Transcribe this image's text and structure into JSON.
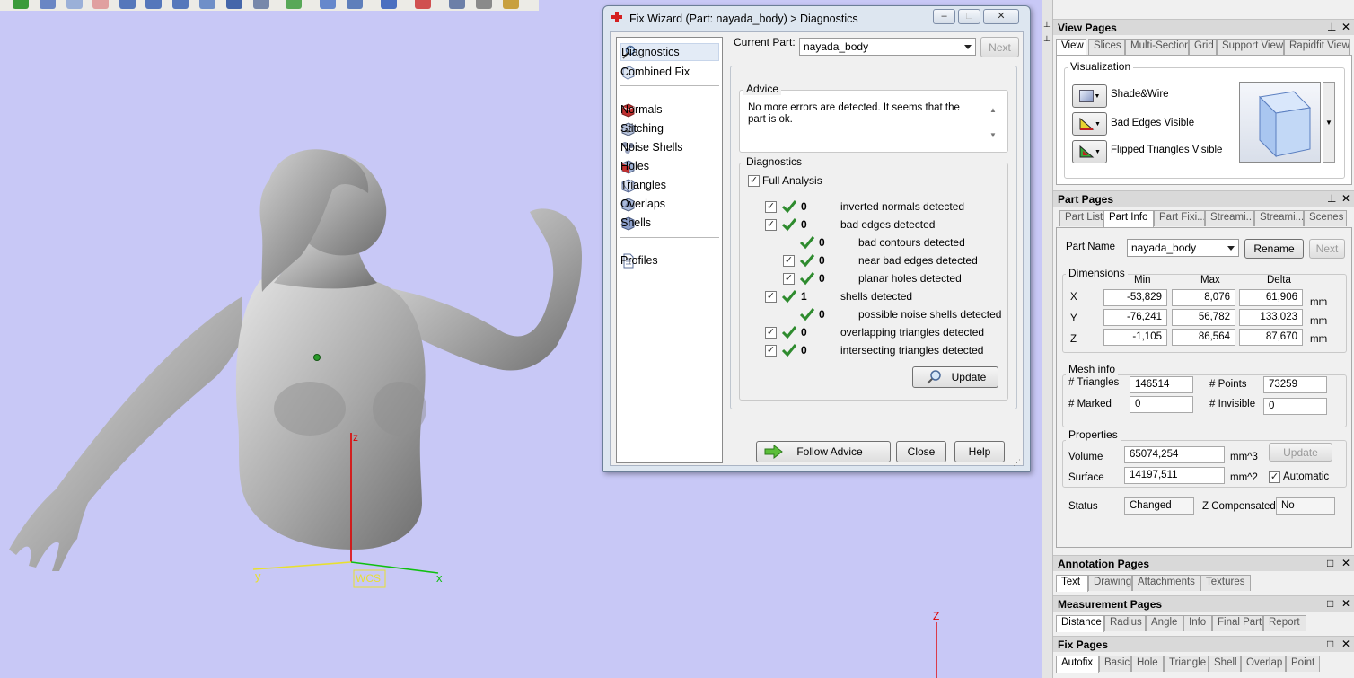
{
  "toolbar": {
    "icons": [
      "fix-icon",
      "search-icon",
      "measure-icon",
      "eraser-icon",
      "cube-icon",
      "cube-icon",
      "cube-icon",
      "arrow-icon",
      "save-icon",
      "view-icon",
      "rotate-icon",
      "cut-icon",
      "move-icon",
      "part-icon",
      "wizard-icon",
      "gear-icon",
      "tools-icon",
      "export-icon"
    ]
  },
  "viewport": {
    "axis_z": "z",
    "axis_y": "y",
    "axis_x": "x",
    "wcs_label": "WCS",
    "corner_axis_z": "Z"
  },
  "dialog": {
    "title": "Fix Wizard (Part: nayada_body) > Diagnostics",
    "nav": {
      "diagnostics": "Diagnostics",
      "combined_fix": "Combined Fix",
      "normals": "Normals",
      "stitching": "Stitching",
      "noise_shells": "Noise Shells",
      "holes": "Holes",
      "triangles": "Triangles",
      "overlaps": "Overlaps",
      "shells": "Shells",
      "profiles": "Profiles"
    },
    "current_part_label": "Current Part:",
    "current_part_value": "nayada_body",
    "next_label": "Next",
    "advice_title": "Advice",
    "advice_text": "No more errors are detected. It seems that the part is ok.",
    "diagnostics_title": "Diagnostics",
    "full_analysis_label": "Full Analysis",
    "rows": [
      {
        "count": "0",
        "text": "inverted normals detected"
      },
      {
        "count": "0",
        "text": "bad edges detected"
      },
      {
        "count": "0",
        "text": "bad contours detected"
      },
      {
        "count": "0",
        "text": "near bad edges detected"
      },
      {
        "count": "0",
        "text": "planar holes detected"
      },
      {
        "count": "1",
        "text": "shells detected"
      },
      {
        "count": "0",
        "text": "possible noise shells detected"
      },
      {
        "count": "0",
        "text": "overlapping triangles detected"
      },
      {
        "count": "0",
        "text": "intersecting triangles detected"
      }
    ],
    "update_label": "Update",
    "follow_advice_label": "Follow Advice",
    "close_label": "Close",
    "help_label": "Help"
  },
  "view_pages": {
    "title": "View Pages",
    "tabs": [
      "View",
      "Slices",
      "Multi-Section",
      "Grid",
      "Support View",
      "Rapidfit View"
    ],
    "visualization_title": "Visualization",
    "shade_wire": "Shade&Wire",
    "bad_edges": "Bad Edges Visible",
    "flipped_triangles": "Flipped Triangles Visible"
  },
  "part_pages": {
    "title": "Part Pages",
    "tabs": [
      "Part List",
      "Part Info",
      "Part Fixi...",
      "Streami...",
      "Streami...",
      "Scenes"
    ],
    "part_name_label": "Part Name",
    "part_name_value": "nayada_body",
    "rename_label": "Rename",
    "next_label": "Next",
    "dimensions_title": "Dimensions",
    "col_min": "Min",
    "col_max": "Max",
    "col_delta": "Delta",
    "x_label": "X",
    "y_label": "Y",
    "z_label": "Z",
    "x_min": "-53,829",
    "x_max": "8,076",
    "x_delta": "61,906",
    "y_min": "-76,241",
    "y_max": "56,782",
    "y_delta": "133,023",
    "z_min": "-1,105",
    "z_max": "86,564",
    "z_delta": "87,670",
    "unit_mm": "mm",
    "mesh_title": "Mesh info",
    "triangles_label": "# Triangles",
    "triangles_value": "146514",
    "points_label": "# Points",
    "points_value": "73259",
    "marked_label": "# Marked",
    "marked_value": "0",
    "invisible_label": "# Invisible",
    "invisible_value": "0",
    "properties_title": "Properties",
    "volume_label": "Volume",
    "volume_value": "65074,254",
    "volume_unit": "mm^3",
    "surface_label": "Surface",
    "surface_value": "14197,511",
    "surface_unit": "mm^2",
    "update_label": "Update",
    "automatic_label": "Automatic",
    "status_label": "Status",
    "status_value": "Changed",
    "zcomp_label": "Z Compensated",
    "zcomp_value": "No"
  },
  "annotation_pages": {
    "title": "Annotation Pages",
    "tabs": [
      "Text",
      "Drawing",
      "Attachments",
      "Textures"
    ]
  },
  "measurement_pages": {
    "title": "Measurement Pages",
    "tabs": [
      "Distance",
      "Radius",
      "Angle",
      "Info",
      "Final Part",
      "Report"
    ]
  },
  "fix_pages": {
    "title": "Fix Pages",
    "tabs": [
      "Autofix",
      "Basic",
      "Hole",
      "Triangle",
      "Shell",
      "Overlap",
      "Point"
    ]
  },
  "colors": {
    "viewport_bg": "#c8c8f6",
    "check_green": "#2e8b2e",
    "axis_red": "#e00000",
    "axis_green": "#10c010",
    "axis_yellow": "#e8e030"
  }
}
